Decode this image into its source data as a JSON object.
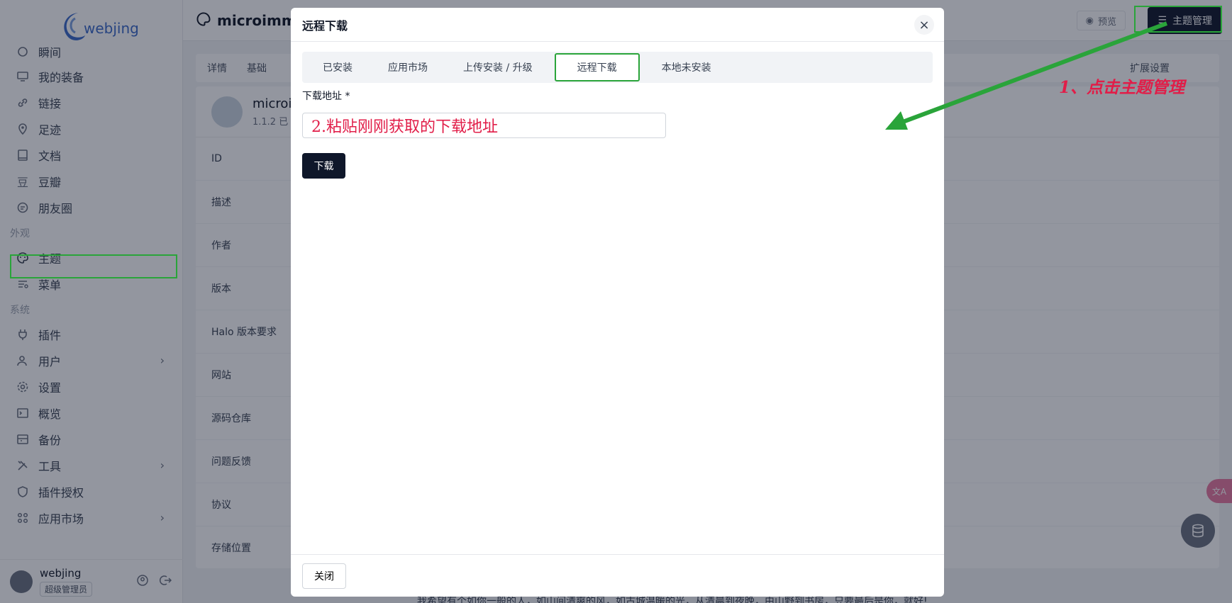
{
  "sidebar": {
    "logo_text": "webjing",
    "items": [
      {
        "label": "瞬间",
        "icon": "moment-icon"
      },
      {
        "label": "我的装备",
        "icon": "monitor-icon"
      },
      {
        "label": "链接",
        "icon": "link-icon"
      },
      {
        "label": "足迹",
        "icon": "location-icon"
      },
      {
        "label": "文档",
        "icon": "book-icon"
      },
      {
        "label": "豆瓣",
        "icon": "douban-icon"
      },
      {
        "label": "朋友圈",
        "icon": "moments-icon"
      }
    ],
    "group_appearance": "外观",
    "appearance_items": [
      {
        "label": "主题",
        "icon": "palette-icon"
      },
      {
        "label": "菜单",
        "icon": "menu-icon"
      }
    ],
    "group_system": "系统",
    "system_items": [
      {
        "label": "插件",
        "icon": "plug-icon"
      },
      {
        "label": "用户",
        "icon": "user-icon"
      },
      {
        "label": "设置",
        "icon": "gear-icon"
      },
      {
        "label": "概览",
        "icon": "terminal-icon"
      },
      {
        "label": "备份",
        "icon": "backup-icon"
      },
      {
        "label": "工具",
        "icon": "tools-icon"
      },
      {
        "label": "插件授权",
        "icon": "shield-icon"
      },
      {
        "label": "应用市场",
        "icon": "grid-icon"
      }
    ],
    "user": {
      "name": "webjing",
      "role": "超级管理员"
    }
  },
  "topbar": {
    "title": "microimme",
    "preview_label": "预览",
    "theme_manage_label": "主题管理"
  },
  "main": {
    "tabs": [
      "详情",
      "基础",
      "扩展设置"
    ],
    "theme_name": "microi",
    "theme_version": "1.1.2",
    "theme_status": "已",
    "rows": [
      "ID",
      "描述",
      "作者",
      "版本",
      "Halo 版本要求",
      "网站",
      "源码仓库",
      "问题反馈",
      "协议",
      "存储位置"
    ],
    "footer_text": "我希望有个如你一般的人，如山间清爽的风，如古城温暖的光，从清晨到夜晚，由山野到书房，只要最后是你，就好!"
  },
  "modal": {
    "title": "远程下载",
    "tabs": [
      "已安装",
      "应用市场",
      "上传安装 / 升级",
      "远程下载",
      "本地未安装"
    ],
    "active_tab": "远程下载",
    "field_label": "下载地址 *",
    "field_value": "2.粘贴刚刚获取的下载地址",
    "download_label": "下载",
    "close_label": "关闭"
  },
  "annotations": {
    "step1": "1、点击主题管理",
    "color_box": "#2aa43a",
    "color_text": "#e11d48"
  }
}
